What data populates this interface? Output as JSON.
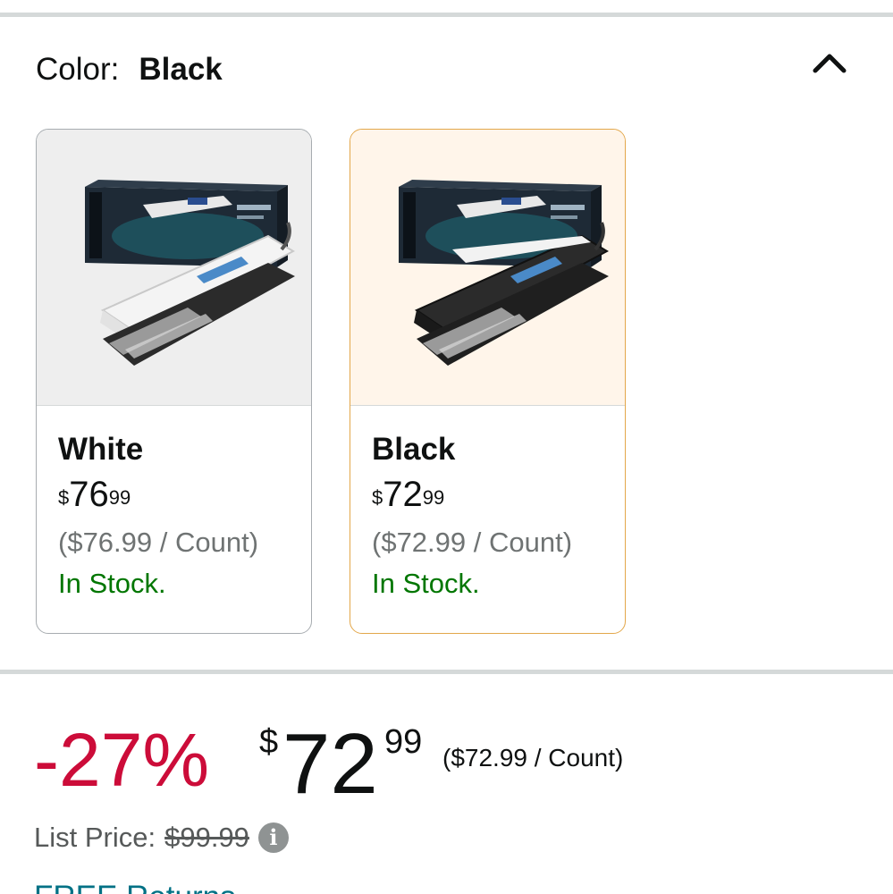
{
  "color_selector": {
    "label": "Color:",
    "selected": "Black",
    "collapse_icon": "chevron-up-icon"
  },
  "swatches": [
    {
      "name": "White",
      "price_symbol": "$",
      "price_whole": "76",
      "price_cents": "99",
      "unit_price": "($76.99 / Count)",
      "stock": "In Stock.",
      "selected": false,
      "image_icon": "hair-straightener-white-icon"
    },
    {
      "name": "Black",
      "price_symbol": "$",
      "price_whole": "72",
      "price_cents": "99",
      "unit_price": "($72.99 / Count)",
      "stock": "In Stock.",
      "selected": true,
      "image_icon": "hair-straightener-black-icon"
    }
  ],
  "price": {
    "discount": "-27%",
    "symbol": "$",
    "whole": "72",
    "cents": "99",
    "unit_price": "($72.99 / Count)",
    "list_price_label": "List Price:",
    "list_price": "$99.99",
    "info_icon": "info-icon"
  },
  "delivery": {
    "free_returns": "FREE Returns"
  },
  "colors": {
    "discount": "#cc0c39",
    "in_stock": "#007600",
    "link": "#007185",
    "selected_border": "#e3a74a",
    "selected_bg": "#fff5ea"
  }
}
